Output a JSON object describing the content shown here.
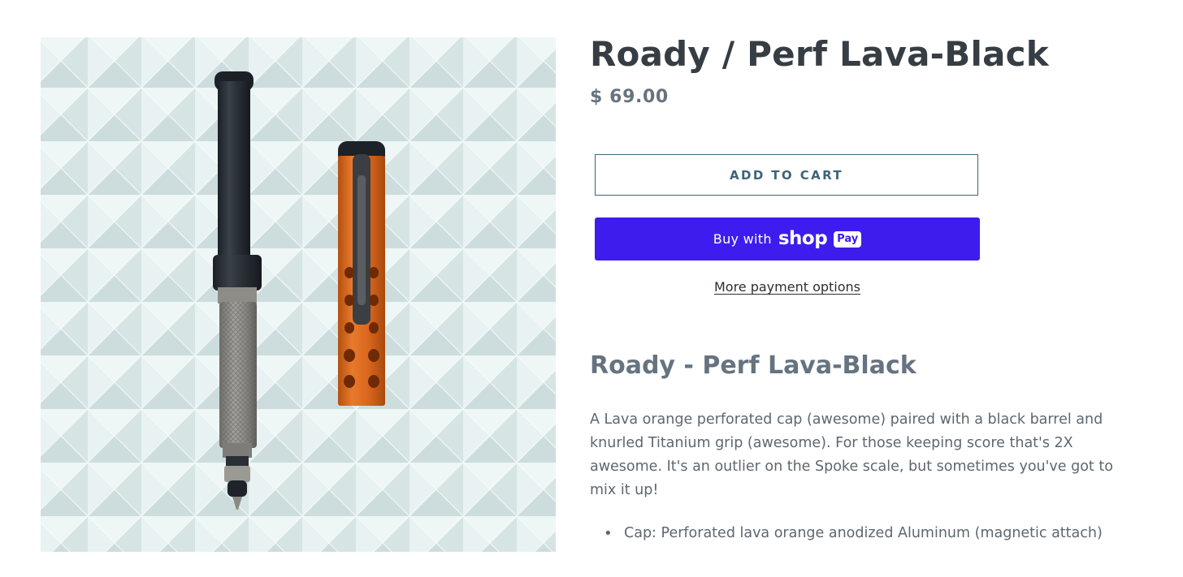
{
  "product": {
    "title": "Roady / Perf Lava-Black",
    "price": "$ 69.00",
    "image_alt": "Roady pen with perforated lava orange cap and black barrel"
  },
  "buttons": {
    "add_to_cart": "ADD TO CART",
    "buy_with": "Buy with",
    "shop_word": "shop",
    "pay_badge": "Pay",
    "more_payment_options": "More payment options"
  },
  "description": {
    "heading": "Roady - Perf Lava-Black",
    "text": "A Lava orange perforated cap (awesome) paired with a black barrel and knurled Titanium grip (awesome). For those keeping score that's 2X awesome. It's an outlier on the Spoke scale, but sometimes you've got to mix it up!",
    "specs": [
      "Cap: Perforated lava orange anodized Aluminum (magnetic attach)"
    ]
  },
  "colors": {
    "shop_pay_purple": "#3f1cee",
    "button_outline": "#3d6478",
    "cap_orange": "#d9661d"
  }
}
